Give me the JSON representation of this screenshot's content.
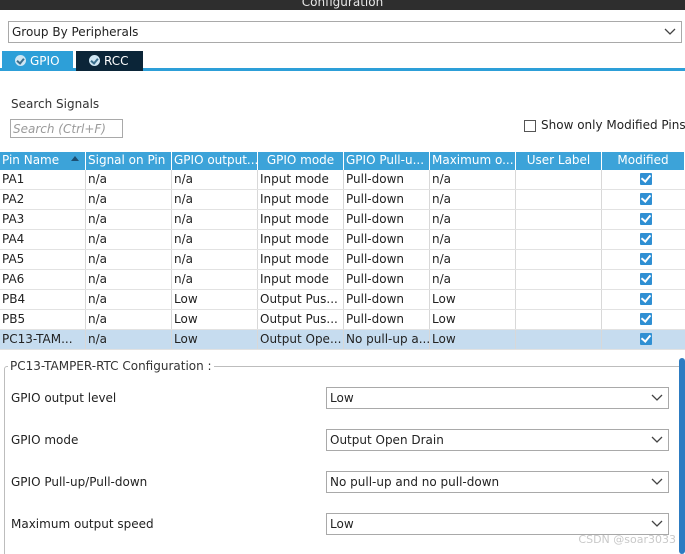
{
  "window": {
    "title": "Configuration"
  },
  "group_by": {
    "value": "Group By Peripherals"
  },
  "tabs": [
    {
      "label": "GPIO",
      "active": true
    },
    {
      "label": "RCC",
      "active": false
    }
  ],
  "search": {
    "label": "Search Signals",
    "placeholder": "Search (Ctrl+F)"
  },
  "filter": {
    "label": "Show only Modified Pins",
    "checked": false
  },
  "table": {
    "columns": [
      "Pin Name",
      "Signal on Pin",
      "GPIO output...",
      "GPIO mode",
      "GPIO Pull-u...",
      "Maximum o...",
      "User Label",
      "Modified"
    ],
    "rows": [
      {
        "pin": "PA1",
        "signal": "n/a",
        "output": "n/a",
        "mode": "Input mode",
        "pull": "Pull-down",
        "speed": "n/a",
        "label": "",
        "modified": true,
        "selected": false
      },
      {
        "pin": "PA2",
        "signal": "n/a",
        "output": "n/a",
        "mode": "Input mode",
        "pull": "Pull-down",
        "speed": "n/a",
        "label": "",
        "modified": true,
        "selected": false
      },
      {
        "pin": "PA3",
        "signal": "n/a",
        "output": "n/a",
        "mode": "Input mode",
        "pull": "Pull-down",
        "speed": "n/a",
        "label": "",
        "modified": true,
        "selected": false
      },
      {
        "pin": "PA4",
        "signal": "n/a",
        "output": "n/a",
        "mode": "Input mode",
        "pull": "Pull-down",
        "speed": "n/a",
        "label": "",
        "modified": true,
        "selected": false
      },
      {
        "pin": "PA5",
        "signal": "n/a",
        "output": "n/a",
        "mode": "Input mode",
        "pull": "Pull-down",
        "speed": "n/a",
        "label": "",
        "modified": true,
        "selected": false
      },
      {
        "pin": "PA6",
        "signal": "n/a",
        "output": "n/a",
        "mode": "Input mode",
        "pull": "Pull-down",
        "speed": "n/a",
        "label": "",
        "modified": true,
        "selected": false
      },
      {
        "pin": "PB4",
        "signal": "n/a",
        "output": "Low",
        "mode": "Output Pus...",
        "pull": "Pull-down",
        "speed": "Low",
        "label": "",
        "modified": true,
        "selected": false
      },
      {
        "pin": "PB5",
        "signal": "n/a",
        "output": "Low",
        "mode": "Output Pus...",
        "pull": "Pull-down",
        "speed": "Low",
        "label": "",
        "modified": true,
        "selected": false
      },
      {
        "pin": "PC13-TAM...",
        "signal": "n/a",
        "output": "Low",
        "mode": "Output Ope...",
        "pull": "No pull-up a...",
        "speed": "Low",
        "label": "",
        "modified": true,
        "selected": true
      }
    ]
  },
  "config": {
    "title": "PC13-TAMPER-RTC Configuration :",
    "fields": [
      {
        "label": "GPIO output level",
        "value": "Low"
      },
      {
        "label": "GPIO mode",
        "value": "Output Open Drain"
      },
      {
        "label": "GPIO Pull-up/Pull-down",
        "value": "No pull-up and no pull-down"
      },
      {
        "label": "Maximum output speed",
        "value": "Low"
      }
    ]
  },
  "watermark": "CSDN @soar3033",
  "colors": {
    "accent": "#2d9fd8",
    "header": "#3ca3d9",
    "selected_row": "#c6dcef",
    "checkbox": "#2f8fd3",
    "tab_inactive": "#0b2538"
  }
}
